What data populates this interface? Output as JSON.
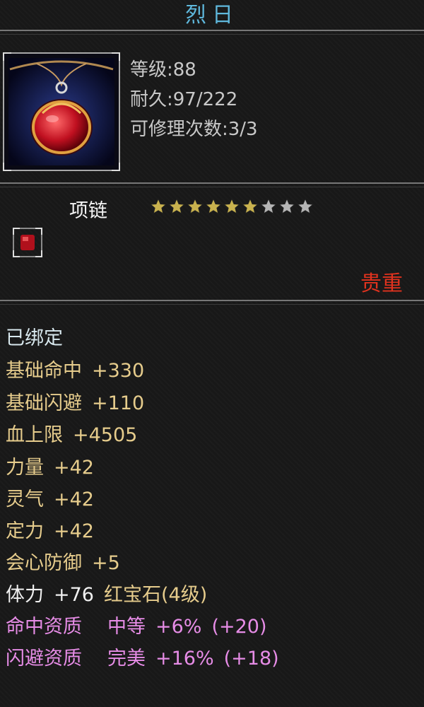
{
  "item": {
    "name": "烈日",
    "level_label": "等级:88",
    "durability_label": "耐久:97/222",
    "repair_label": "可修理次数:3/3",
    "type": "项链",
    "stars_filled": 6,
    "stars_total": 9,
    "rarity": "贵重",
    "bound": "已绑定"
  },
  "attributes": [
    {
      "name": "基础命中",
      "value": "+330"
    },
    {
      "name": "基础闪避",
      "value": "+110"
    },
    {
      "name": "血上限",
      "value": "+4505"
    },
    {
      "name": "力量",
      "value": "+42"
    },
    {
      "name": "灵气",
      "value": "+42"
    },
    {
      "name": "定力",
      "value": "+42"
    },
    {
      "name": "会心防御",
      "value": "+5"
    }
  ],
  "gem_line": {
    "name": "体力",
    "value": "+76",
    "gem": "红宝石(4级)"
  },
  "qualities": [
    {
      "name": "命中资质",
      "grade": "中等",
      "bonus": "+6%",
      "extra": "(+20)"
    },
    {
      "name": "闪避资质",
      "grade": "完美",
      "bonus": "+16%",
      "extra": "(+18)"
    }
  ],
  "colors": {
    "title": "#5fb8dc",
    "rarity": "#e0321e",
    "attribute": "#e6cc8c",
    "quality": "#e68ce6",
    "star_filled": "#c9b24e",
    "star_empty": "#b4b4b4"
  },
  "icons": {
    "item": "ruby-necklace-icon",
    "gem_slot": "ruby-gem-icon"
  }
}
